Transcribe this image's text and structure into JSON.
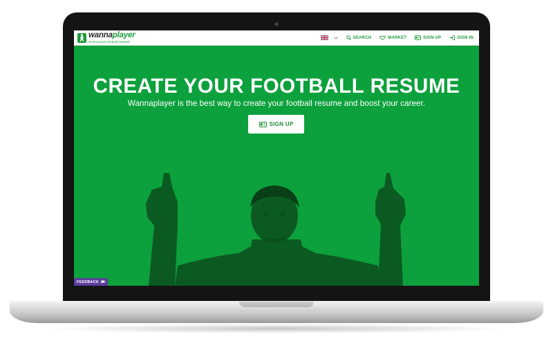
{
  "site": {
    "brand_prefix": "wanna",
    "brand_suffix": "player",
    "tagline": "Professional Football Network"
  },
  "nav": {
    "language": "en-GB flag",
    "items": [
      {
        "label": "SEARCH",
        "icon": "search-icon"
      },
      {
        "label": "MARKET",
        "icon": "handshake-icon"
      },
      {
        "label": "SIGN UP",
        "icon": "id-card-icon"
      },
      {
        "label": "SIGN IN",
        "icon": "sign-in-icon"
      }
    ]
  },
  "hero": {
    "title": "CREATE YOUR FOOTBALL RESUME",
    "subtitle": "Wannaplayer is the best way to create your football resume and boost your career.",
    "cta_label": "SIGN UP"
  },
  "feedback": {
    "label": "FEEDBACK"
  },
  "colors": {
    "brand_green": "#1e9a3b",
    "hero_green": "#0ca13c",
    "feedback_purple": "#5b3d9e"
  }
}
